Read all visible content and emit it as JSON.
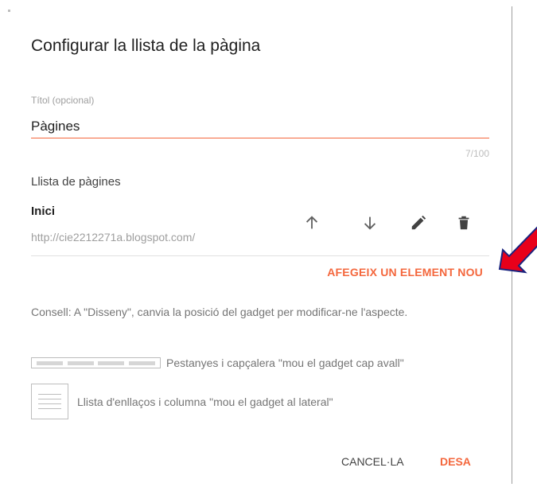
{
  "dialog": {
    "title": "Configurar la llista de la pàgina",
    "title_field": {
      "label": "Títol (opcional)",
      "value": "Pàgines",
      "counter": "7/100"
    },
    "list": {
      "heading": "Llista de pàgines",
      "items": [
        {
          "name": "Inici",
          "url": "http://cie2212271a.blogspot.com/"
        }
      ],
      "icons": [
        "arrow-up-icon",
        "arrow-down-icon",
        "pencil-icon",
        "trash-icon"
      ]
    },
    "add_element_label": "AFEGEIX UN ELEMENT NOU",
    "hint": "Consell: A \"Disseny\", canvia la posició del gadget per modificar-ne l'aspecte.",
    "layout_options": [
      {
        "text": "Pestanyes i capçalera \"mou el gadget cap avall\""
      },
      {
        "text": "Llista d'enllaços i columna \"mou el gadget al lateral\""
      }
    ],
    "buttons": {
      "cancel": "CANCEL·LA",
      "save": "DESA"
    }
  },
  "colors": {
    "accent": "#f4673d",
    "annotation_arrow": "#e8001a",
    "annotation_arrow_outline": "#1a237e"
  }
}
